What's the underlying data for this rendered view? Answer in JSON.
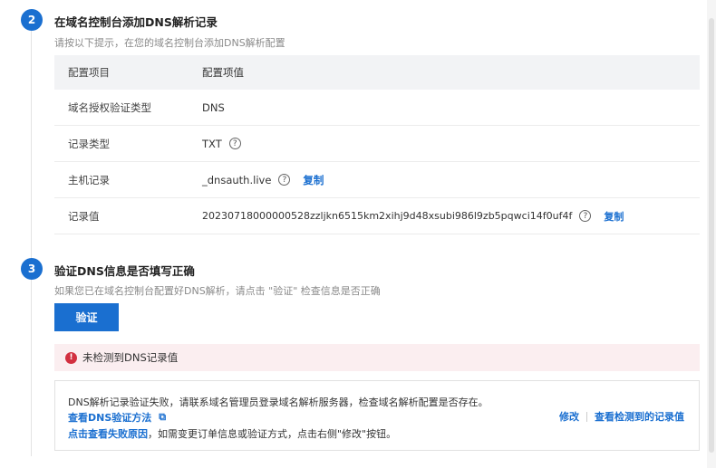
{
  "step2": {
    "number": "2",
    "title": "在域名控制台添加DNS解析记录",
    "desc": "请按以下提示，在您的域名控制台添加DNS解析配置"
  },
  "table": {
    "headers": [
      "配置项目",
      "配置项值"
    ],
    "rows": [
      {
        "label": "域名授权验证类型",
        "value": "DNS",
        "help": false,
        "copy": false
      },
      {
        "label": "记录类型",
        "value": "TXT",
        "help": true,
        "copy": false
      },
      {
        "label": "主机记录",
        "value": "_dnsauth.live",
        "help": true,
        "copy": true
      },
      {
        "label": "记录值",
        "value": "20230718000000528zzljkn6515km2xihj9d48xsubi986l9zb5pqwci14f0uf4f",
        "help": true,
        "copy": true
      }
    ],
    "copy_label": "复制",
    "help_glyph": "?"
  },
  "step3": {
    "number": "3",
    "title": "验证DNS信息是否填写正确",
    "desc": "如果您已在域名控制台配置好DNS解析，请点击 \"验证\" 检查信息是否正确"
  },
  "verify_button": "验证",
  "error_alert": {
    "icon": "!",
    "text": "未检测到DNS记录值"
  },
  "info_box": {
    "line1": "DNS解析记录验证失败，请联系域名管理员登录域名解析服务器，检查域名解析配置是否存在。",
    "link_method": "查看DNS验证方法",
    "ext_icon": "⧉",
    "link_reason": "点击查看失败原因",
    "line3_rest": "，如需变更订单信息或验证方式，点击右侧\"修改\"按钮。",
    "action_edit": "修改",
    "action_view": "查看检测到的记录值"
  },
  "colors": {
    "accent": "#1a6fd0",
    "error": "#d23040",
    "error_bg": "#fbeef0"
  }
}
